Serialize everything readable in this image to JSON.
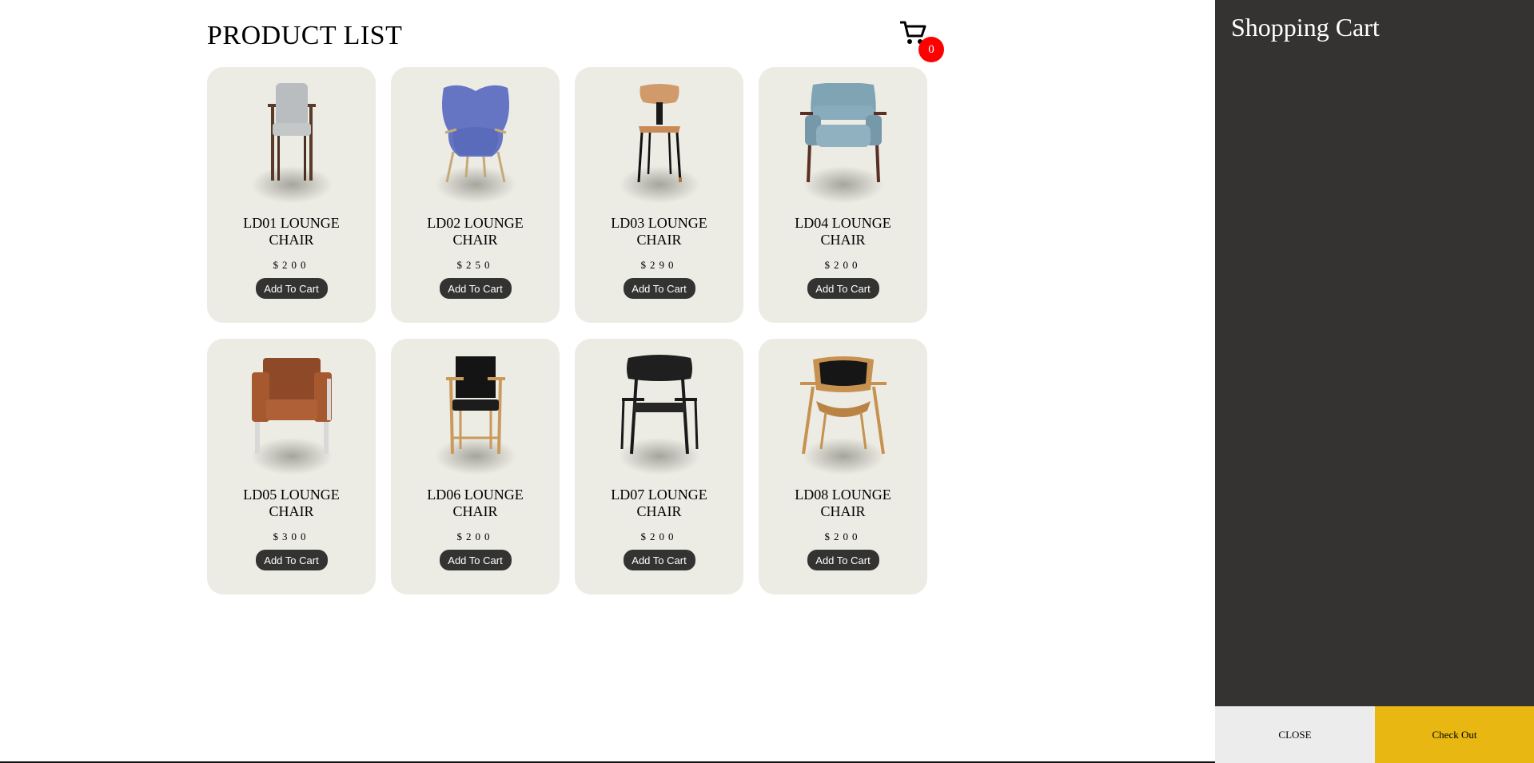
{
  "header": {
    "title": "PRODUCT LIST",
    "cart_count": "0",
    "cart_icon": "shopping-cart-icon"
  },
  "products": [
    {
      "name": "LD01 LOUNGE CHAIR",
      "price": "$200",
      "button_label": "Add To Cart",
      "image": "grey-upholstered-armchair"
    },
    {
      "name": "LD02 LOUNGE CHAIR",
      "price": "$250",
      "button_label": "Add To Cart",
      "image": "blue-wingback-lounge-chair"
    },
    {
      "name": "LD03 LOUNGE CHAIR",
      "price": "$290",
      "button_label": "Add To Cart",
      "image": "plywood-side-chair"
    },
    {
      "name": "LD04 LOUNGE CHAIR",
      "price": "$200",
      "button_label": "Add To Cart",
      "image": "teal-cushioned-armchair"
    },
    {
      "name": "LD05 LOUNGE CHAIR",
      "price": "$300",
      "button_label": "Add To Cart",
      "image": "brown-leather-armchair"
    },
    {
      "name": "LD06 LOUNGE CHAIR",
      "price": "$200",
      "button_label": "Add To Cart",
      "image": "black-leather-oak-armchair"
    },
    {
      "name": "LD07 LOUNGE CHAIR",
      "price": "$200",
      "button_label": "Add To Cart",
      "image": "black-wood-lounge-chair"
    },
    {
      "name": "LD08 LOUNGE CHAIR",
      "price": "$200",
      "button_label": "Add To Cart",
      "image": "oak-black-back-lounge-chair"
    }
  ],
  "cart_panel": {
    "title": "Shopping Cart",
    "close_label": "CLOSE",
    "checkout_label": "Check Out"
  },
  "colors": {
    "card_background": "#ecebe4",
    "button_background": "#333332",
    "badge": "#ff0000",
    "panel_background": "#343332",
    "checkout": "#e8b711",
    "close": "#ececec"
  }
}
